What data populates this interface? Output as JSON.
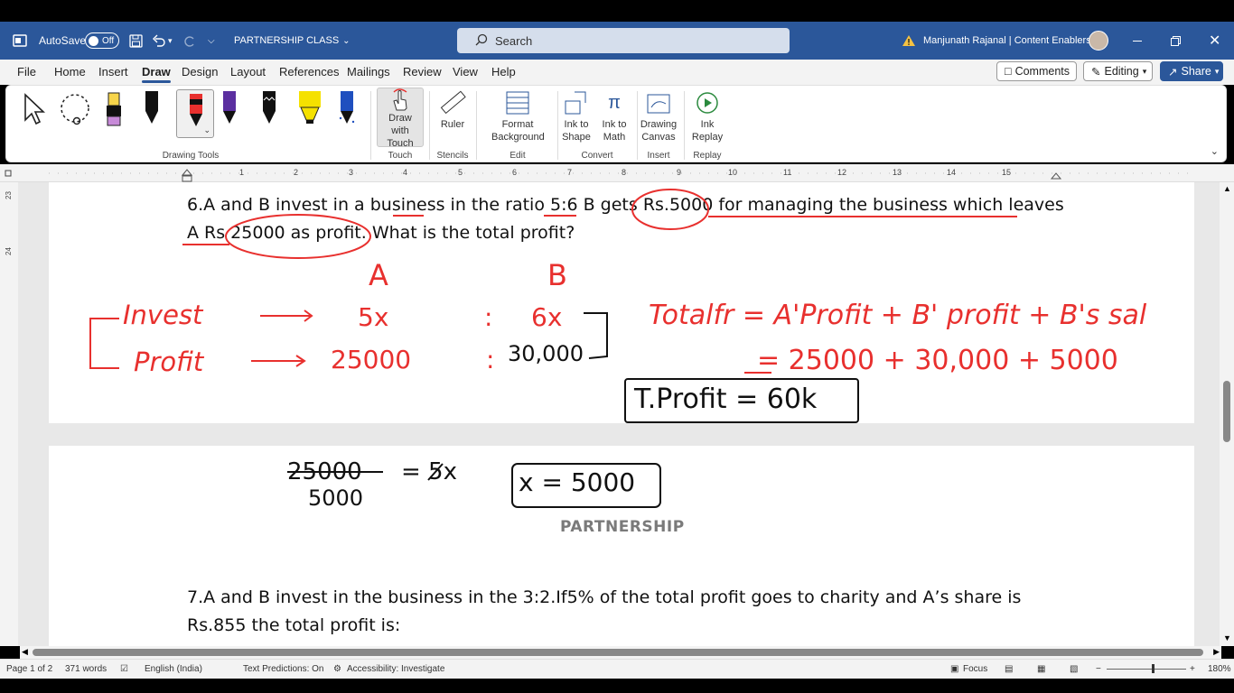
{
  "titlebar": {
    "autosave_label": "AutoSave",
    "autosave_state": "Off",
    "doc_title": "PARTNERSHIP CLASS",
    "search_placeholder": "Search",
    "user_name": "Manjunath Rajanal | Content Enablers"
  },
  "menu": {
    "tabs": [
      "File",
      "Home",
      "Insert",
      "Draw",
      "Design",
      "Layout",
      "References",
      "Mailings",
      "Review",
      "View",
      "Help"
    ],
    "active_tab": "Draw",
    "comments_label": "Comments",
    "editing_label": "Editing",
    "share_label": "Share"
  },
  "ribbon": {
    "groups": {
      "drawing_tools": "Drawing Tools",
      "touch": "Touch",
      "stencils": "Stencils",
      "edit": "Edit",
      "convert": "Convert",
      "insert": "Insert",
      "replay": "Replay"
    },
    "buttons": {
      "draw_with_touch": "Draw with Touch",
      "ruler": "Ruler",
      "format_background": "Format Background",
      "ink_to_shape": "Ink to Shape",
      "ink_to_math": "Ink to Math",
      "drawing_canvas": "Drawing Canvas",
      "ink_replay": "Ink Replay"
    },
    "pen_colors": [
      "#f7d54a",
      "#111111",
      "#e8302e",
      "#5b2fa0",
      "#111111",
      "#f5e100",
      "#1f4fbf"
    ]
  },
  "ruler_numbers": [
    "1",
    "2",
    "3",
    "4",
    "5",
    "6",
    "7",
    "8",
    "9",
    "10",
    "11",
    "12",
    "13",
    "14",
    "15"
  ],
  "vruler_numbers": [
    "23",
    "24"
  ],
  "document": {
    "q6_line1": "6.A and B invest in a business in the ratio 5:6 B gets Rs.5000 for managing the business which leaves",
    "q6_line2": "A Rs  25000 as profit. What is the total profit?",
    "page_title": "PARTNERSHIP",
    "q7_line1": "7.A and B invest in the business in the 3:2.If5% of the total profit goes to charity and A’s share is",
    "q7_line2": "Rs.855 the total profit is:"
  },
  "ink": {
    "col_a": "A",
    "col_b": "B",
    "invest": "Invest",
    "profit": "Profit",
    "invest_a": "5x",
    "invest_b": "6x",
    "profit_a": "25000",
    "profit_b": "30,000",
    "total_eq": "Totalfr = A'Profit + B' profit + B's sal",
    "total_values": "= 25000 + 30,000 + 5000",
    "total_result": "T.Profit = 60k",
    "calc_top": "25000",
    "calc_eq": "= 5x",
    "calc_bottom": "5000",
    "x_result": "x = 5000"
  },
  "status": {
    "page": "Page 1 of 2",
    "words": "371 words",
    "language": "English (India)",
    "predictions": "Text Predictions: On",
    "accessibility": "Accessibility: Investigate",
    "focus": "Focus",
    "zoom": "180%"
  }
}
